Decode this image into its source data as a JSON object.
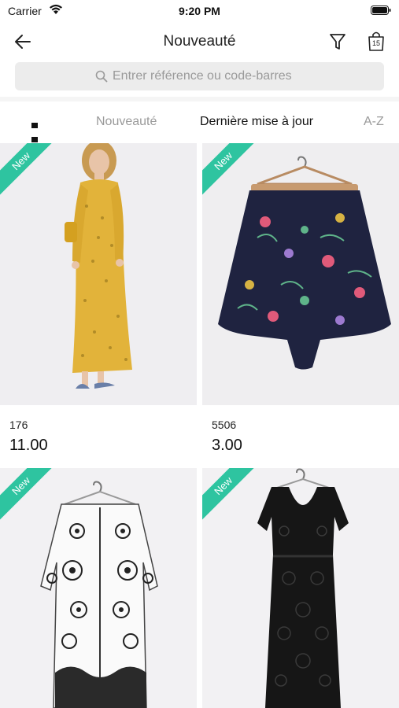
{
  "status_bar": {
    "carrier": "Carrier",
    "time": "9:20 PM"
  },
  "nav": {
    "title": "Nouveauté",
    "cart_count": "15"
  },
  "search": {
    "placeholder": "Entrer référence ou code-barres"
  },
  "sort": {
    "options": [
      "Nouveauté",
      "Dernière mise à jour",
      "A-Z"
    ],
    "active": "Dernière mise à jour"
  },
  "products": [
    {
      "badge": "New",
      "ref": "176",
      "price": "11.00",
      "image": "yellow-floral-maxi-dress"
    },
    {
      "badge": "New",
      "ref": "5506",
      "price": "3.00",
      "image": "navy-floral-shorts"
    },
    {
      "badge": "New",
      "ref": "",
      "price": "",
      "image": "white-embroidered-kimono"
    },
    {
      "badge": "New",
      "ref": "",
      "price": "",
      "image": "black-lace-dress"
    }
  ],
  "colors": {
    "badge": "#2ec4a0",
    "search_bg": "#ececec",
    "photo_bg": "#eeecef"
  }
}
